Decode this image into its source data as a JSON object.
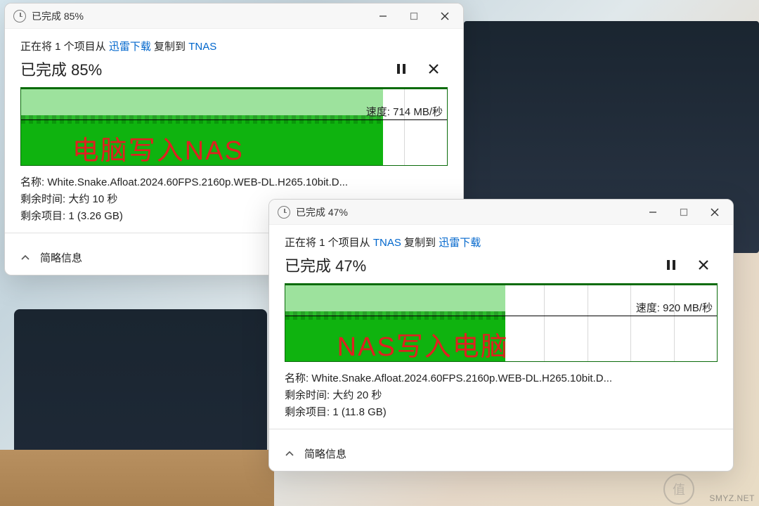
{
  "dialog1": {
    "window_title": "已完成 85%",
    "copy_prefix": "正在将 1 个项目从 ",
    "copy_src": "迅雷下载",
    "copy_mid": " 复制到 ",
    "copy_dst": "TNAS",
    "heading": "已完成 85%",
    "speed_prefix": "速度: ",
    "speed_value": "714 MB/秒",
    "annotation": "电脑写入NAS",
    "name_label": "名称: ",
    "name_value": "White.Snake.Afloat.2024.60FPS.2160p.WEB-DL.H265.10bit.D...",
    "time_remaining_label": "剩余时间: ",
    "time_remaining_value": "大约 10 秒",
    "items_remaining_label": "剩余项目: ",
    "items_remaining_value": "1 (3.26 GB)",
    "footer": "简略信息",
    "chart_fill_percent": 85
  },
  "dialog2": {
    "window_title": "已完成 47%",
    "copy_prefix": "正在将 1 个项目从 ",
    "copy_src": "TNAS",
    "copy_mid": " 复制到 ",
    "copy_dst": "迅雷下载",
    "heading": "已完成 47%",
    "speed_prefix": "速度: ",
    "speed_value": "920 MB/秒",
    "annotation": "NAS写入电脑",
    "name_label": "名称: ",
    "name_value": "White.Snake.Afloat.2024.60FPS.2160p.WEB-DL.H265.10bit.D...",
    "time_remaining_label": "剩余时间: ",
    "time_remaining_value": "大约 20 秒",
    "items_remaining_label": "剩余项目: ",
    "items_remaining_value": "1 (11.8 GB)",
    "footer": "简略信息",
    "chart_fill_percent": 51
  },
  "watermark_text": "SMYZ.NET",
  "watermark_badge": "值"
}
